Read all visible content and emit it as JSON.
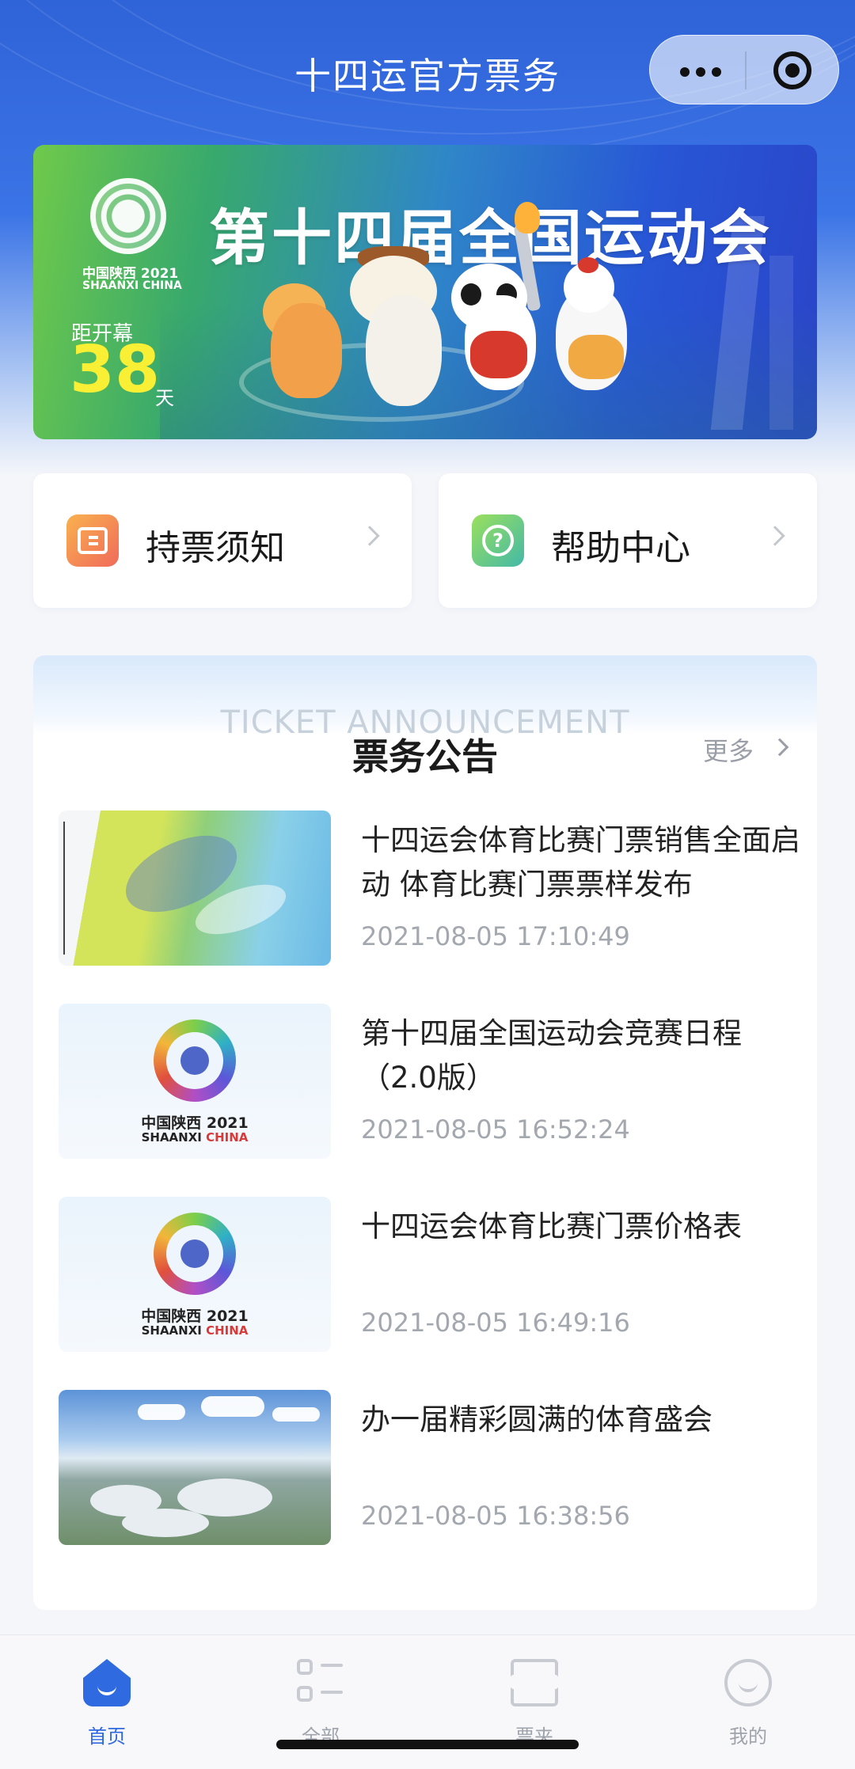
{
  "nav": {
    "title": "十四运官方票务"
  },
  "banner": {
    "logo_cn": "中国陕西 2021",
    "logo_en": "SHAANXI CHINA",
    "title": "第十四届全国运动会",
    "countdown_label": "距开幕",
    "countdown_days": "38",
    "countdown_unit": "天"
  },
  "quick_links": [
    {
      "label": "持票须知",
      "icon": "ticket-icon",
      "color": "#f28a52"
    },
    {
      "label": "帮助中心",
      "icon": "help-icon",
      "color": "#5cc49a"
    }
  ],
  "announcements": {
    "bg_text": "TICKET ANNOUNCEMENT",
    "title": "票务公告",
    "more_label": "更多",
    "items": [
      {
        "title": "十四运会体育比赛门票销售全面启动 体育比赛门票票样发布",
        "time": "2021-08-05 17:10:49",
        "thumb": "ticket-sample"
      },
      {
        "title": "第十四届全国运动会竞赛日程（2.0版）",
        "time": "2021-08-05 16:52:24",
        "thumb": "logo",
        "thumb_cn": "中国陕西 2021",
        "thumb_en_a": "SHAANXI ",
        "thumb_en_b": "CHINA"
      },
      {
        "title": "十四运会体育比赛门票价格表",
        "time": "2021-08-05 16:49:16",
        "thumb": "logo",
        "thumb_cn": "中国陕西 2021",
        "thumb_en_a": "SHAANXI ",
        "thumb_en_b": "CHINA"
      },
      {
        "title": "办一届精彩圆满的体育盛会",
        "time": "2021-08-05 16:38:56",
        "thumb": "stadium-photo"
      }
    ]
  },
  "tabbar": {
    "items": [
      {
        "label": "首页",
        "icon": "home-icon",
        "active": true
      },
      {
        "label": "全部",
        "icon": "grid-icon",
        "active": false
      },
      {
        "label": "票夹",
        "icon": "ticket-wallet-icon",
        "active": false
      },
      {
        "label": "我的",
        "icon": "profile-icon",
        "active": false
      }
    ]
  },
  "colors": {
    "header_blue": "#2f63d8",
    "accent_blue": "#2f6ae0",
    "countdown_yellow": "#f9ef34"
  }
}
